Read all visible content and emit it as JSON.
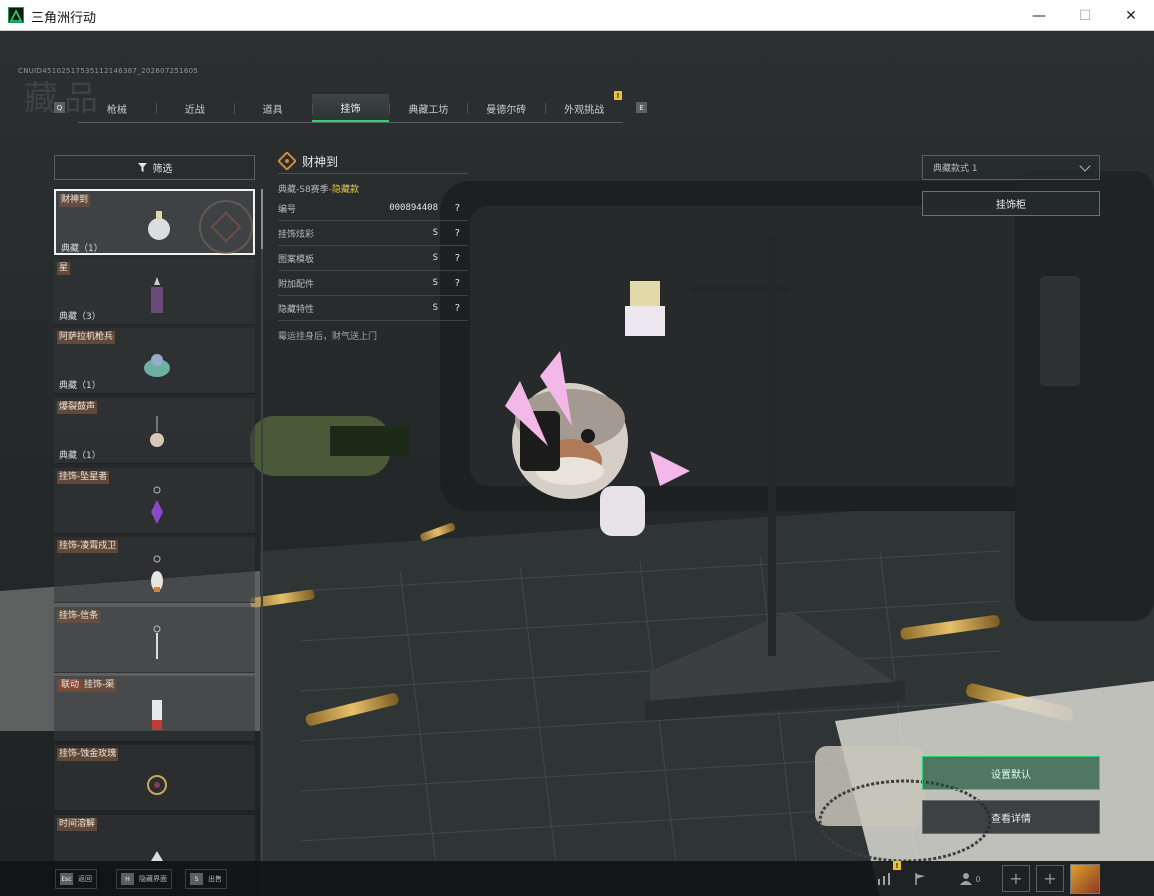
{
  "window": {
    "title": "三角洲行动",
    "minimize": "—",
    "maximize": "☐",
    "close": "✕"
  },
  "uid": "CNUID45102517535112146387_202607251605",
  "watermark": "藏品",
  "keys": {
    "prev": "Q",
    "next": "E"
  },
  "tabs": [
    {
      "label": "枪械"
    },
    {
      "label": "近战"
    },
    {
      "label": "道具"
    },
    {
      "label": "挂饰",
      "active": true
    },
    {
      "label": "典藏工坊"
    },
    {
      "label": "曼德尔砖"
    },
    {
      "label": "外观挑战",
      "notice": "!"
    }
  ],
  "filter": {
    "label": "筛选"
  },
  "items": [
    {
      "name": "财神到",
      "count": "典藏（1）",
      "selected": true
    },
    {
      "name": "星",
      "count": "典藏（3）"
    },
    {
      "name": "阿萨拉机枪兵",
      "count": "典藏（1）"
    },
    {
      "name": "爆裂鼓声",
      "count": "典藏（1）"
    },
    {
      "name": "挂饰-坠星者",
      "count": ""
    },
    {
      "name": "挂饰-凌霄戍卫",
      "count": ""
    },
    {
      "name": "挂饰-信条",
      "count": ""
    },
    {
      "name": "挂饰-渠",
      "tag": "联动",
      "count": ""
    },
    {
      "name": "挂饰-蚀金玫瑰",
      "count": ""
    },
    {
      "name": "时间溶解",
      "count": ""
    }
  ],
  "details": {
    "title": "财神到",
    "subtitle_prefix": "典藏-S8赛季-",
    "subtitle_highlight": "隐藏款",
    "rows": [
      {
        "label": "编号",
        "value": "000894408",
        "help": "?"
      },
      {
        "label": "挂饰炫彩",
        "value": "S",
        "help": "?"
      },
      {
        "label": "图案模板",
        "value": "S",
        "help": "?"
      },
      {
        "label": "附加配件",
        "value": "S",
        "help": "?"
      },
      {
        "label": "隐藏特性",
        "value": "S",
        "help": "?"
      }
    ],
    "description": "霉运挂身后，财气送上门"
  },
  "style_select": {
    "value": "典藏款式 1"
  },
  "cabinet_button": "挂饰柜",
  "set_default_button": "设置默认",
  "view_details_button": "查看详情",
  "bottom": {
    "hints": [
      {
        "key": "Esc",
        "label": "返回"
      },
      {
        "key": "H",
        "label": "隐藏界面"
      },
      {
        "key": "S",
        "label": "出售"
      }
    ],
    "friends_count": "0",
    "stats_notice": "!"
  },
  "colors": {
    "accent": "#2fd07a",
    "highlight": "#e3c64a",
    "notice": "#e8c23c"
  }
}
